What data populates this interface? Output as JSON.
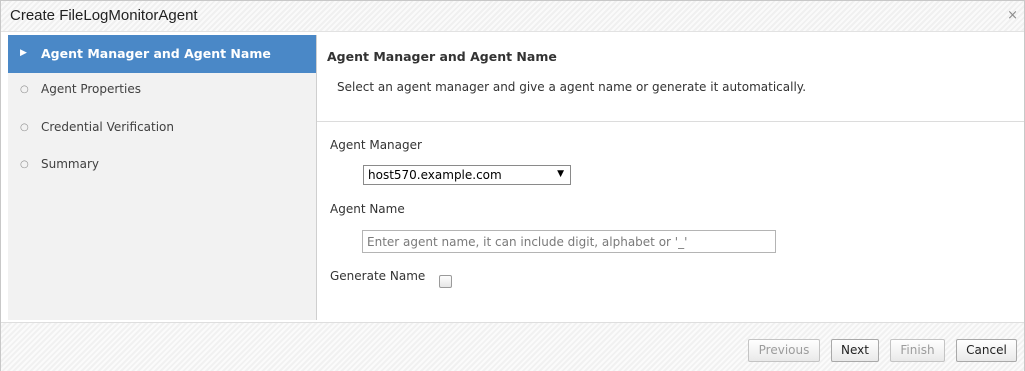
{
  "dialog": {
    "title": "Create FileLogMonitorAgent",
    "close_symbol": "×"
  },
  "steps": [
    {
      "label": "Agent Manager and Agent Name",
      "marker": "▶",
      "active": true
    },
    {
      "label": "Agent Properties",
      "marker": "○",
      "active": false
    },
    {
      "label": "Credential Verification",
      "marker": "○",
      "active": false
    },
    {
      "label": "Summary",
      "marker": "○",
      "active": false
    }
  ],
  "content": {
    "section_title": "Agent Manager and Agent Name",
    "description": "Select an agent manager and give a agent name or generate it automatically.",
    "agent_manager_label": "Agent Manager",
    "agent_manager_value": "host570.example.com",
    "dropdown_arrow": "▼",
    "agent_name_label": "Agent Name",
    "agent_name_value": "",
    "agent_name_placeholder": "Enter agent name, it can include digit, alphabet or '_'",
    "generate_name_label": "Generate Name",
    "generate_name_checked": false
  },
  "buttons": {
    "previous": "Previous",
    "next": "Next",
    "finish": "Finish",
    "cancel": "Cancel"
  },
  "colors": {
    "active_step_bg": "#4a88c7"
  }
}
